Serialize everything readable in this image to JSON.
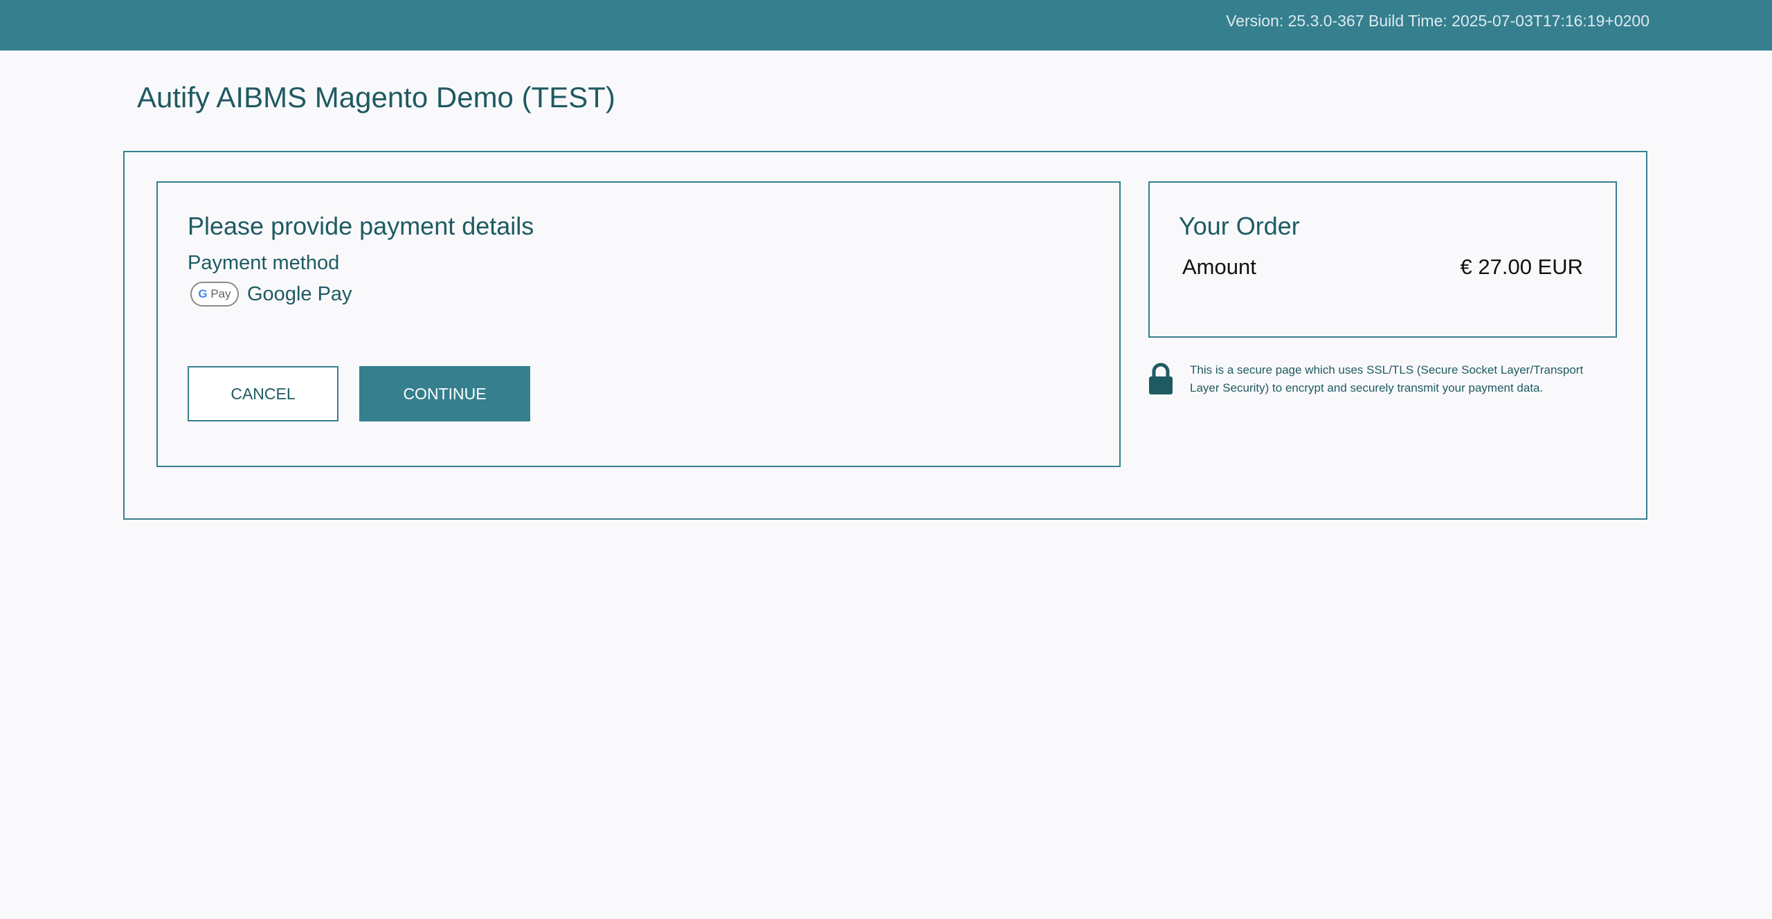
{
  "header": {
    "version_text": "Version: 25.3.0-367 Build Time: 2025-07-03T17:16:19+0200"
  },
  "shop": {
    "title": "Autify AIBMS Magento Demo (TEST)"
  },
  "payment": {
    "heading": "Please provide payment details",
    "method_label": "Payment method",
    "method_name": "Google Pay",
    "method_icon": "google-pay-icon",
    "cancel_label": "CANCEL",
    "continue_label": "CONTINUE"
  },
  "order": {
    "heading": "Your Order",
    "amount_label": "Amount",
    "amount_value": "€ 27.00 EUR"
  },
  "security": {
    "icon": "lock-icon",
    "text": "This is a secure page which uses SSL/TLS (Secure Socket Layer/Transport Layer Security) to encrypt and securely transmit your payment data."
  },
  "colors": {
    "brand": "#367f8f",
    "heading_text": "#1f5a62",
    "background": "#f9f9fb"
  }
}
